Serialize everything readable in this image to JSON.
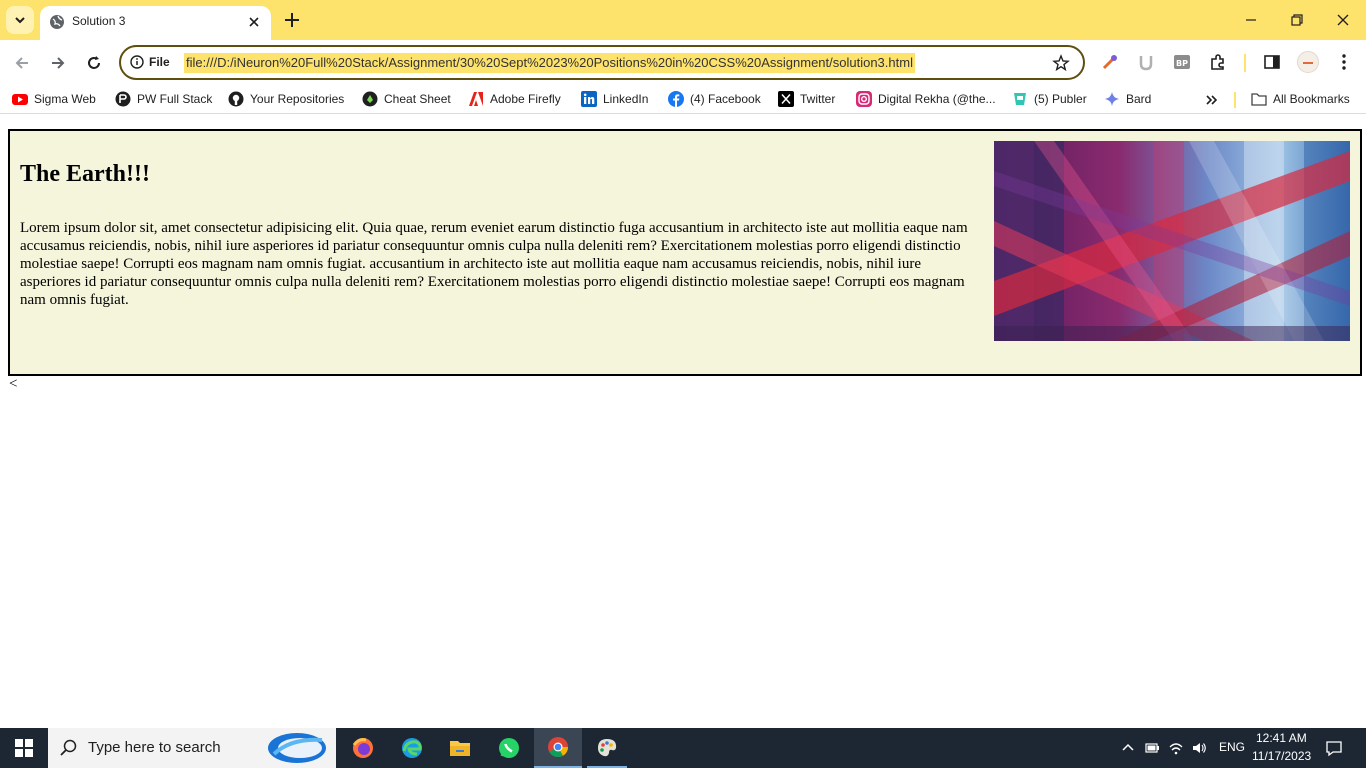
{
  "browser": {
    "tab_title": "Solution 3",
    "site_info_label": "File",
    "url": "file:///D:/iNeuron%20Full%20Stack/Assignment/30%20Sept%2023%20Positions%20in%20CSS%20Assignment/solution3.html",
    "accent": "#fde26c",
    "bookmarks": [
      {
        "label": "Sigma Web",
        "icon": "youtube-icon"
      },
      {
        "label": "PW Full Stack",
        "icon": "pw-icon"
      },
      {
        "label": "Your Repositories",
        "icon": "github-icon"
      },
      {
        "label": "Cheat Sheet",
        "icon": "cheatsheet-icon"
      },
      {
        "label": "Adobe Firefly",
        "icon": "adobe-icon"
      },
      {
        "label": "LinkedIn",
        "icon": "linkedin-icon"
      },
      {
        "label": "(4) Facebook",
        "icon": "facebook-icon"
      },
      {
        "label": "Twitter",
        "icon": "x-icon"
      },
      {
        "label": "Digital Rekha (@the...",
        "icon": "instagram-icon"
      },
      {
        "label": "(5) Publer",
        "icon": "publer-icon"
      },
      {
        "label": "Bard",
        "icon": "bard-icon"
      }
    ],
    "all_bookmarks_label": "All Bookmarks"
  },
  "page": {
    "heading": "The Earth!!!",
    "paragraph": "Lorem ipsum dolor sit, amet consectetur adipisicing elit. Quia quae, rerum eveniet earum distinctio fuga accusantium in architecto iste aut mollitia eaque nam accusamus reiciendis, nobis, nihil iure asperiores id pariatur consequuntur omnis culpa nulla deleniti rem? Exercitationem molestias porro eligendi distinctio molestiae saepe! Corrupti eos magnam nam omnis fugiat. accusantium in architecto iste aut mollitia eaque nam accusamus reiciendis, nobis, nihil iure asperiores id pariatur consequuntur omnis culpa nulla deleniti rem? Exercitationem molestias porro eligendi distinctio molestiae saepe! Corrupti eos magnam nam omnis fugiat.",
    "stray_text": "<",
    "card_background": "#f5f5dc"
  },
  "taskbar": {
    "search_placeholder": "Type here to search",
    "language": "ENG",
    "time": "12:41 AM",
    "date": "11/17/2023"
  }
}
